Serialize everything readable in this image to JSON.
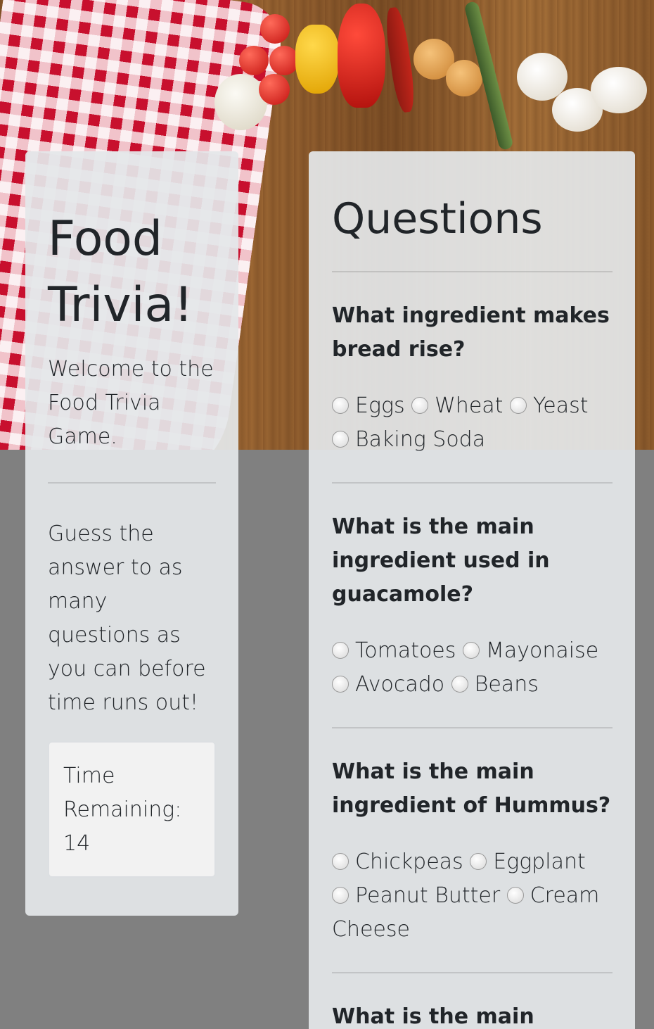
{
  "header": {
    "title": "Food Trivia!",
    "subtitle": "Welcome to the Food Trivia Game."
  },
  "instructions": "Guess the answer to as many questions as you can before time runs out!",
  "timer": {
    "label": "Time Remaining:",
    "value": "14"
  },
  "questions_title": "Questions",
  "questions": [
    {
      "text": "What ingredient makes bread rise?",
      "options": [
        "Eggs",
        "Wheat",
        "Yeast",
        "Baking Soda"
      ]
    },
    {
      "text": "What is the main ingredient used in guacamole?",
      "options": [
        "Tomatoes",
        "Mayonaise",
        "Avocado",
        "Beans"
      ]
    },
    {
      "text": "What is the main ingredient of Hummus?",
      "options": [
        "Chickpeas",
        "Eggplant",
        "Peanut Butter",
        "Cream Cheese"
      ]
    },
    {
      "text": "What is the main export out of Cuba?",
      "options": []
    }
  ]
}
